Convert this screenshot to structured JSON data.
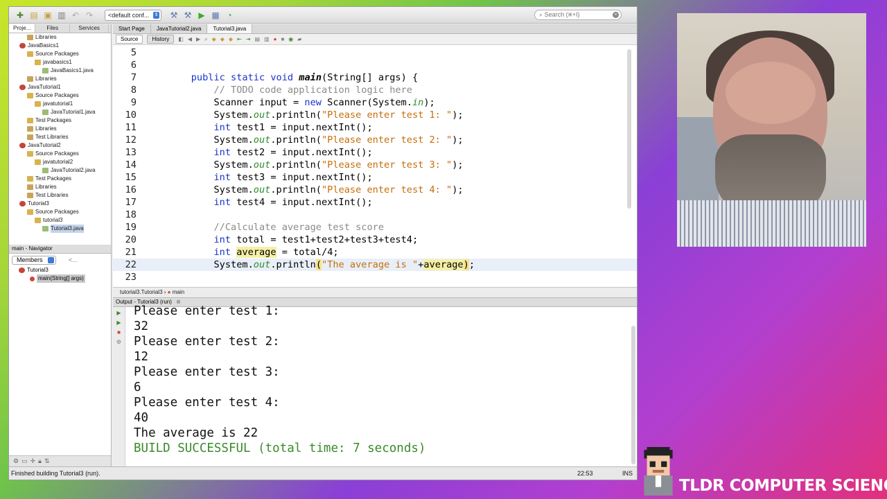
{
  "toolbar": {
    "config": "<default conf...",
    "search_placeholder": "Search (⌘+I)"
  },
  "projects_panel": {
    "tabs": [
      "Proje...",
      "Files",
      "Services"
    ],
    "tree": [
      {
        "label": "Libraries",
        "indent": 2,
        "icon": "lib"
      },
      {
        "label": "JavaBasics1",
        "indent": 1,
        "icon": "proj"
      },
      {
        "label": "Source Packages",
        "indent": 2,
        "icon": "pkg"
      },
      {
        "label": "javabasics1",
        "indent": 3,
        "icon": "pkg"
      },
      {
        "label": "JavaBasics1.java",
        "indent": 4,
        "icon": "file"
      },
      {
        "label": "Libraries",
        "indent": 2,
        "icon": "lib"
      },
      {
        "label": "JavaTutorial1",
        "indent": 1,
        "icon": "proj"
      },
      {
        "label": "Source Packages",
        "indent": 2,
        "icon": "pkg"
      },
      {
        "label": "javatutorial1",
        "indent": 3,
        "icon": "pkg"
      },
      {
        "label": "JavaTutorial1.java",
        "indent": 4,
        "icon": "file"
      },
      {
        "label": "Test Packages",
        "indent": 2,
        "icon": "pkg"
      },
      {
        "label": "Libraries",
        "indent": 2,
        "icon": "lib"
      },
      {
        "label": "Test Libraries",
        "indent": 2,
        "icon": "lib"
      },
      {
        "label": "JavaTutorial2",
        "indent": 1,
        "icon": "proj"
      },
      {
        "label": "Source Packages",
        "indent": 2,
        "icon": "pkg"
      },
      {
        "label": "javatutorial2",
        "indent": 3,
        "icon": "pkg"
      },
      {
        "label": "JavaTutorial2.java",
        "indent": 4,
        "icon": "file"
      },
      {
        "label": "Test Packages",
        "indent": 2,
        "icon": "pkg"
      },
      {
        "label": "Libraries",
        "indent": 2,
        "icon": "lib"
      },
      {
        "label": "Test Libraries",
        "indent": 2,
        "icon": "lib"
      },
      {
        "label": "Tutorial3",
        "indent": 1,
        "icon": "proj"
      },
      {
        "label": "Source Packages",
        "indent": 2,
        "icon": "pkg"
      },
      {
        "label": "tutorial3",
        "indent": 3,
        "icon": "pkg"
      },
      {
        "label": "Tutorial3.java",
        "indent": 4,
        "icon": "file",
        "selected": true
      }
    ]
  },
  "navigator": {
    "title": "main - Navigator",
    "members": "Members",
    "filter": "<...",
    "class": "Tutorial3",
    "method": "main(String[] args)"
  },
  "editor": {
    "tabs": [
      "Start Page",
      "JavaTutorial2.java",
      "Tutorial3.java"
    ],
    "source_tab": "Source",
    "history_tab": "History",
    "breadcrumb_class": "tutorial3.Tutorial3",
    "breadcrumb_method": "main",
    "lines": [
      {
        "n": "5",
        "html": ""
      },
      {
        "n": "6",
        "html": ""
      },
      {
        "n": "7",
        "html": "    <span class='kw'>public</span> <span class='kw'>static</span> <span class='kw'>void</span> <span class='mn'>main</span>(String[] args) {"
      },
      {
        "n": "8",
        "html": "        <span class='cm'>// TODO code application logic here</span>"
      },
      {
        "n": "9",
        "html": "        Scanner input = <span class='kw'>new</span> Scanner(System.<span class='fd'>in</span>);"
      },
      {
        "n": "10",
        "html": "        System.<span class='fd'>out</span>.println(<span class='st'>\"Please enter test 1: \"</span>);"
      },
      {
        "n": "11",
        "html": "        <span class='kw'>int</span> test1 = input.nextInt();"
      },
      {
        "n": "12",
        "html": "        System.<span class='fd'>out</span>.println(<span class='st'>\"Please enter test 2: \"</span>);"
      },
      {
        "n": "13",
        "html": "        <span class='kw'>int</span> test2 = input.nextInt();"
      },
      {
        "n": "14",
        "html": "        System.<span class='fd'>out</span>.println(<span class='st'>\"Please enter test 3: \"</span>);"
      },
      {
        "n": "15",
        "html": "        <span class='kw'>int</span> test3 = input.nextInt();"
      },
      {
        "n": "16",
        "html": "        System.<span class='fd'>out</span>.println(<span class='st'>\"Please enter test 4: \"</span>);"
      },
      {
        "n": "17",
        "html": "        <span class='kw'>int</span> test4 = input.nextInt();"
      },
      {
        "n": "18",
        "html": ""
      },
      {
        "n": "19",
        "html": "        <span class='cm'>//Calculate average test score</span>"
      },
      {
        "n": "20",
        "html": "        <span class='kw'>int</span> total = test1+test2+test3+test4;"
      },
      {
        "n": "21",
        "html": "        <span class='kw'>int</span> <span class='hl'>average</span> = total/4;"
      },
      {
        "n": "22",
        "html": "        System.<span class='fd'>out</span>.println<span class='bracket'>(</span><span class='st'>\"The average is \"</span>+<span class='hl'>average</span><span class='bracket'>)</span>;",
        "highlight": true
      },
      {
        "n": "23",
        "html": ""
      }
    ]
  },
  "output": {
    "title": "Output - Tutorial3 (run)",
    "lines": [
      {
        "text": "Please enter test 1:"
      },
      {
        "text": "32"
      },
      {
        "text": "Please enter test 2:"
      },
      {
        "text": "12"
      },
      {
        "text": "Please enter test 3:"
      },
      {
        "text": "6"
      },
      {
        "text": "Please enter test 4:"
      },
      {
        "text": "40"
      },
      {
        "text": "The average is 22"
      },
      {
        "text": "BUILD SUCCESSFUL (total time: 7 seconds)",
        "success": true
      }
    ]
  },
  "status": {
    "message": "Finished building Tutorial3 (run).",
    "position": "22:53",
    "mode": "INS"
  },
  "overlay": {
    "brand": "TLDR COMPUTER SCIENCE"
  },
  "colors": {
    "keyword": "#1a33c8",
    "string": "#c56e0a",
    "comment": "#8a8a8a",
    "success": "#3a8a2a"
  }
}
